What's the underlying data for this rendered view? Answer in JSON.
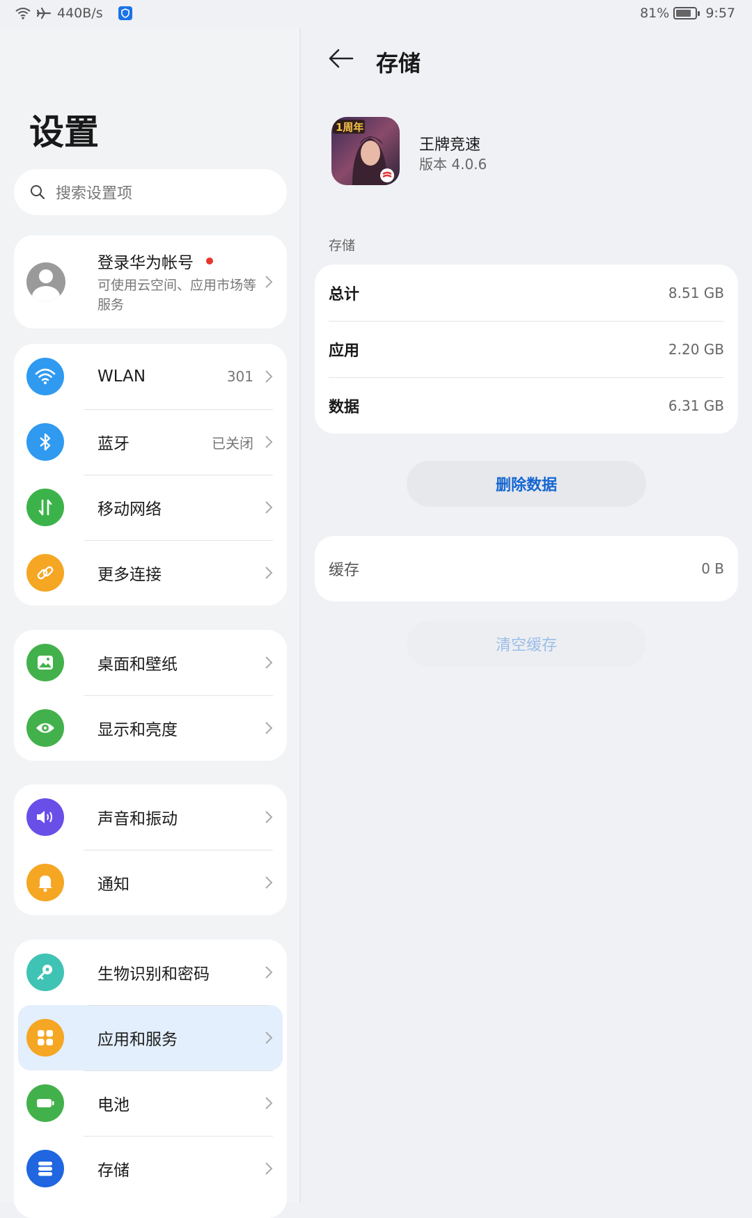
{
  "status_bar": {
    "net_speed": "440B/s",
    "battery_level": "81%",
    "battery_fraction": 0.81,
    "time": "9:57",
    "icons": [
      "wifi-icon",
      "airplane-icon",
      "shield-icon",
      "battery-icon"
    ]
  },
  "settings": {
    "title": "设置",
    "search_placeholder": "搜索设置项",
    "account": {
      "title": "登录华为帐号",
      "subtitle": "可使用云空间、应用市场等服务"
    },
    "groups": [
      {
        "items": [
          {
            "label": "WLAN",
            "value": "301",
            "icon": "wifi-icon",
            "color": "#2f9af0"
          },
          {
            "label": "蓝牙",
            "value": "已关闭",
            "icon": "bluetooth-icon",
            "color": "#2f9af0"
          },
          {
            "label": "移动网络",
            "value": "",
            "icon": "mobile-data-icon",
            "color": "#3cb34a"
          },
          {
            "label": "更多连接",
            "value": "",
            "icon": "link-icon",
            "color": "#f5a623"
          }
        ]
      },
      {
        "items": [
          {
            "label": "桌面和壁纸",
            "icon": "wallpaper-icon",
            "color": "#43b14b"
          },
          {
            "label": "显示和亮度",
            "icon": "eye-icon",
            "color": "#43b14b"
          }
        ]
      },
      {
        "items": [
          {
            "label": "声音和振动",
            "icon": "speaker-icon",
            "color": "#6a4ee8"
          },
          {
            "label": "通知",
            "icon": "bell-icon",
            "color": "#f5a623"
          }
        ]
      },
      {
        "items": [
          {
            "label": "生物识别和密码",
            "icon": "key-icon",
            "color": "#3fc3b4"
          },
          {
            "label": "应用和服务",
            "icon": "apps-icon",
            "color": "#f5a623",
            "selected": true
          },
          {
            "label": "电池",
            "icon": "battery-icon",
            "color": "#43b14b"
          },
          {
            "label": "存储",
            "icon": "storage-icon",
            "color": "#1f66e0"
          }
        ]
      }
    ]
  },
  "detail": {
    "title": "存储",
    "app_name": "王牌竞速",
    "app_version": "版本 4.0.6",
    "app_icon_badge": "1周年",
    "storage_section_label": "存储",
    "storage_rows": [
      {
        "label": "总计",
        "value": "8.51 GB"
      },
      {
        "label": "应用",
        "value": "2.20 GB"
      },
      {
        "label": "数据",
        "value": "6.31 GB"
      }
    ],
    "delete_data_button": "删除数据",
    "cache_label": "缓存",
    "cache_value": "0 B",
    "clear_cache_button": "清空缓存"
  }
}
